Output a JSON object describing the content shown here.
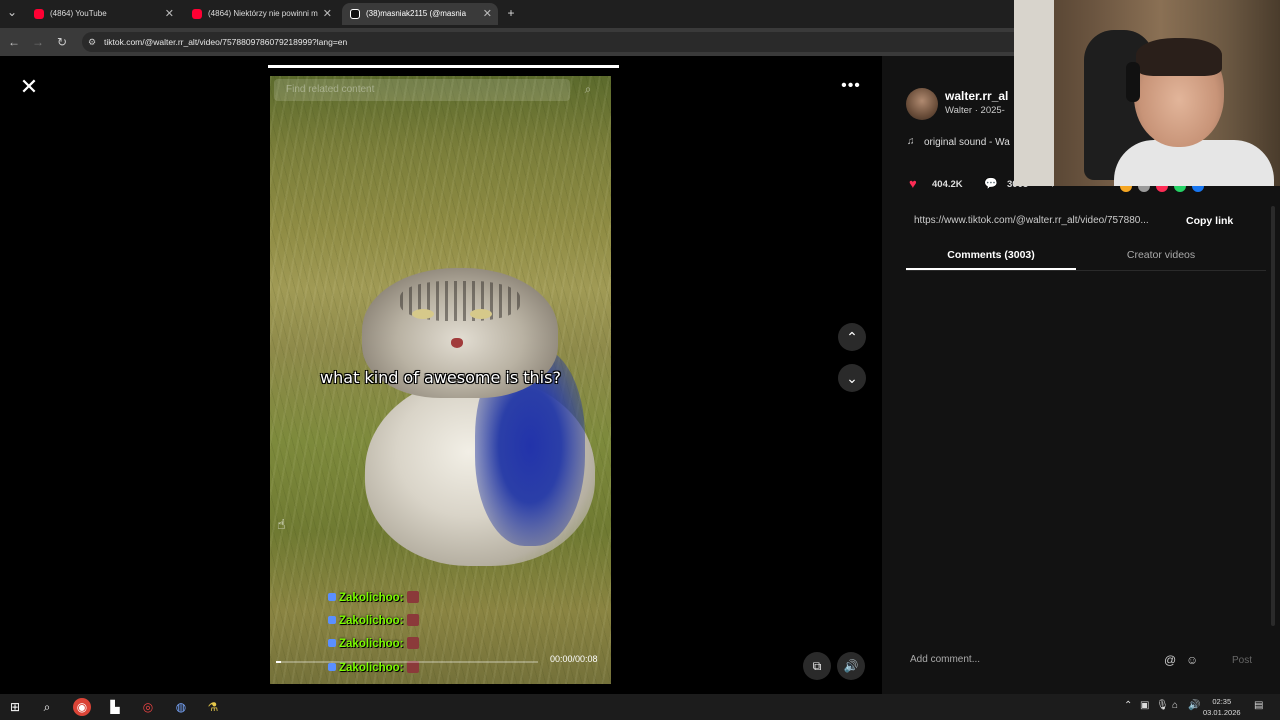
{
  "browser": {
    "tabs": [
      {
        "title": "(4864) YouTube",
        "icon_color": "#ff0033"
      },
      {
        "title": "(4864) Niektórzy nie powinni m",
        "icon_color": "#ff0033"
      },
      {
        "title": "(38)masniak2115 (@masnia",
        "icon_color": "#ffffff"
      }
    ],
    "new_tab_icon": "plus-icon",
    "url": "tiktok.com/@walter.rr_alt/video/7578809786079218999?lang=en"
  },
  "video": {
    "search_placeholder": "Find related content",
    "caption": "what kind of awesome is this?",
    "chat_lines": [
      "Zakolichoo:",
      "Zakolichoo:",
      "Zakolichoo:",
      "Zakolichoo:"
    ],
    "time": "00:00/00:08",
    "progress": 0.02
  },
  "panel": {
    "username": "walter.rr_al",
    "subline": "Walter · 2025-",
    "sound": "original sound - Wa",
    "likes": "404.2K",
    "comments_count": "3003",
    "link": "https://www.tiktok.com/@walter.rr_alt/video/757880...",
    "copy_link": "Copy link",
    "tabs": [
      "Comments (3003)",
      "Creator videos"
    ],
    "add_comment": "Add comment...",
    "post": "Post"
  },
  "taskbar": {
    "time": "02:35",
    "date": "03.01.2026"
  },
  "colors": {
    "accent": "#fe2c55",
    "chat_green": "#7cfc00",
    "panel_bg": "#121212"
  }
}
